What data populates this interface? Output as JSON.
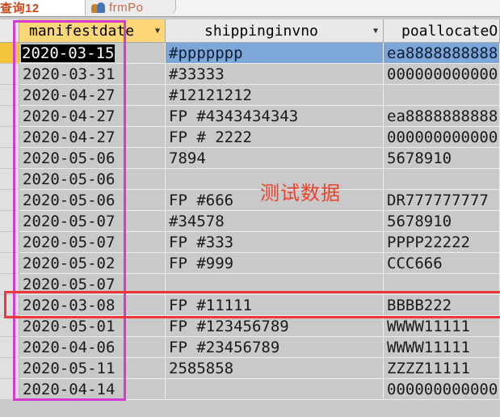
{
  "tabs": [
    {
      "label": "查询12",
      "icon": "datasheet-icon"
    },
    {
      "label": "frmPo",
      "icon": "form-icon"
    }
  ],
  "columns": [
    {
      "label": "manifestdate",
      "selected": true
    },
    {
      "label": "shippinginvno",
      "selected": false
    },
    {
      "label": "poallocateO",
      "selected": false
    }
  ],
  "rows": [
    {
      "manifestdate": "2020-03-15",
      "shippinginvno": "#ppppppp",
      "poallocate": "ea8888888888",
      "current": true
    },
    {
      "manifestdate": "2020-03-31",
      "shippinginvno": "#33333",
      "poallocate": "000000000000"
    },
    {
      "manifestdate": "2020-04-27",
      "shippinginvno": "#12121212",
      "poallocate": ""
    },
    {
      "manifestdate": "2020-04-27",
      "shippinginvno": "FP #4343434343",
      "poallocate": "ea8888888888"
    },
    {
      "manifestdate": "2020-04-27",
      "shippinginvno": "FP # 2222",
      "poallocate": "000000000000"
    },
    {
      "manifestdate": "2020-05-06",
      "shippinginvno": "7894",
      "poallocate": "5678910"
    },
    {
      "manifestdate": "2020-05-06",
      "shippinginvno": "",
      "poallocate": ""
    },
    {
      "manifestdate": "2020-05-06",
      "shippinginvno": "FP #666",
      "poallocate": "DR777777777"
    },
    {
      "manifestdate": "2020-05-07",
      "shippinginvno": "#34578",
      "poallocate": "5678910"
    },
    {
      "manifestdate": "2020-05-07",
      "shippinginvno": "FP #333",
      "poallocate": "PPPP22222"
    },
    {
      "manifestdate": "2020-05-02",
      "shippinginvno": "FP #999",
      "poallocate": "CCC666"
    },
    {
      "manifestdate": "2020-05-07",
      "shippinginvno": "",
      "poallocate": ""
    },
    {
      "manifestdate": "2020-03-08",
      "shippinginvno": "FP #11111",
      "poallocate": "BBBB222"
    },
    {
      "manifestdate": "2020-05-01",
      "shippinginvno": "FP #123456789",
      "poallocate": "WWWW11111"
    },
    {
      "manifestdate": "2020-04-06",
      "shippinginvno": "FP #23456789",
      "poallocate": "WWWW11111"
    },
    {
      "manifestdate": "2020-05-11",
      "shippinginvno": "2585858",
      "poallocate": "ZZZZ11111"
    },
    {
      "manifestdate": "2020-04-14",
      "shippinginvno": "",
      "poallocate": "000000000000"
    }
  ],
  "annotation": {
    "text": "测试数据"
  },
  "colors": {
    "magenta_box": "#d63bd6",
    "red_box": "#ef3838",
    "annotation_text": "#e8442c",
    "selected_row": "#7da7d9",
    "header_selected": "#ffd776"
  }
}
